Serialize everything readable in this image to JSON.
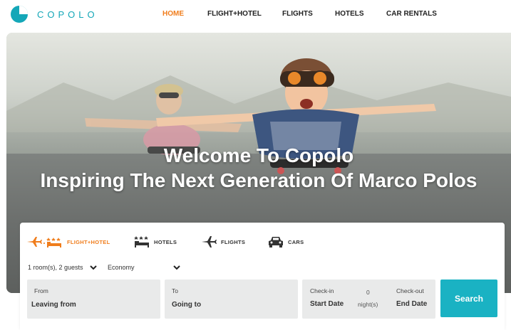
{
  "brand": {
    "name": "COPOLO",
    "color": "#14a7b8"
  },
  "nav": {
    "items": [
      {
        "label": "HOME",
        "active": true
      },
      {
        "label": "FLIGHT+HOTEL",
        "active": false
      },
      {
        "label": "FLIGHTS",
        "active": false
      },
      {
        "label": "HOTELS",
        "active": false
      },
      {
        "label": "CAR RENTALS",
        "active": false
      }
    ],
    "active_color": "#f07d1c"
  },
  "hero": {
    "line1": "Welcome To Copolo",
    "line2": "Inspiring The Next Generation Of Marco Polos"
  },
  "search": {
    "tabs": [
      {
        "label": "FLIGHT+HOTEL",
        "icon": "plane-bed-icon",
        "active": true
      },
      {
        "label": "HOTELS",
        "icon": "hotel-icon",
        "active": false
      },
      {
        "label": "FLIGHTS",
        "icon": "plane-icon",
        "active": false
      },
      {
        "label": "CARS",
        "icon": "car-icon",
        "active": false
      }
    ],
    "rooms_guests": "1 room(s), 2 guests",
    "cabin_class": "Economy",
    "from": {
      "label": "From",
      "placeholder": "Leaving from"
    },
    "to": {
      "label": "To",
      "placeholder": "Going to"
    },
    "checkin": {
      "label": "Check-in",
      "value": "Start Date"
    },
    "checkout": {
      "label": "Check-out",
      "value": "End Date"
    },
    "nights": {
      "count": "0",
      "label": "night(s)"
    },
    "button": "Search",
    "accent": "#1ab2c3"
  }
}
